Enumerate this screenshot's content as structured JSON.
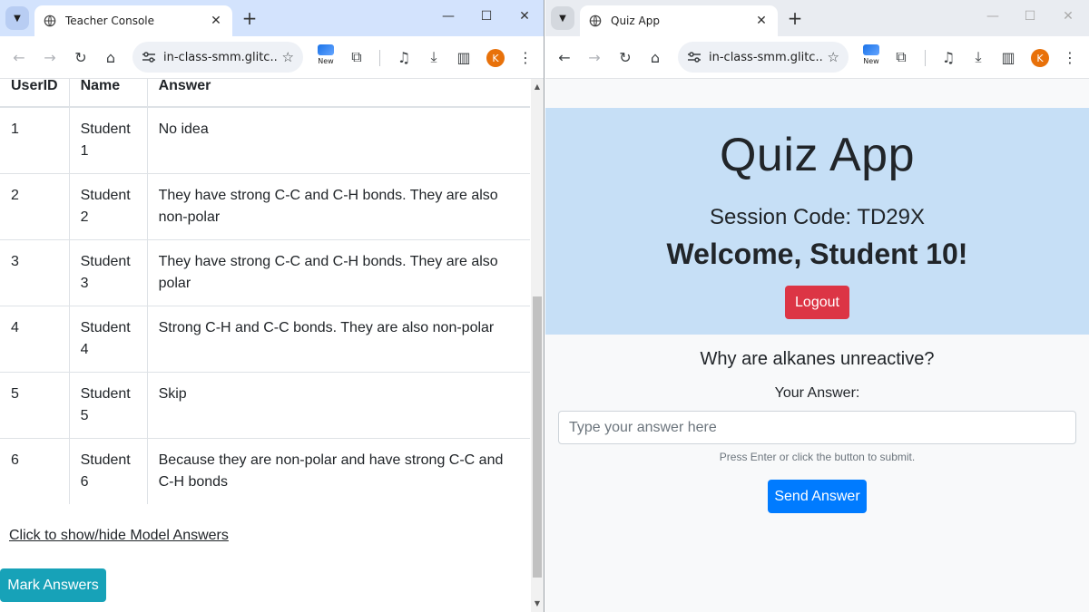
{
  "left_window": {
    "tab_title": "Teacher Console",
    "url": "in-class-smm.glitc...",
    "avatar_letter": "K",
    "new_badge": "New"
  },
  "right_window": {
    "tab_title": "Quiz App",
    "url": "in-class-smm.glitc...",
    "avatar_letter": "K",
    "new_badge": "New"
  },
  "teacher": {
    "columns": [
      "UserID",
      "Name",
      "Answer"
    ],
    "rows": [
      {
        "id": "1",
        "name": "Student 1",
        "answer": "No idea"
      },
      {
        "id": "2",
        "name": "Student 2",
        "answer": "They have strong C-C and C-H bonds. They are also non-polar"
      },
      {
        "id": "3",
        "name": "Student 3",
        "answer": "They have strong C-C and C-H bonds. They are also polar"
      },
      {
        "id": "4",
        "name": "Student 4",
        "answer": "Strong C-H and C-C bonds. They are also non-polar"
      },
      {
        "id": "5",
        "name": "Student 5",
        "answer": "Skip"
      },
      {
        "id": "6",
        "name": "Student 6",
        "answer": "Because they are non-polar and have strong C-C and C-H bonds"
      }
    ],
    "model_answers_link": "Click to show/hide Model Answers",
    "mark_button": "Mark Answers"
  },
  "quiz": {
    "title": "Quiz App",
    "session": "Session Code: TD29X",
    "welcome": "Welcome, Student 10!",
    "logout": "Logout",
    "question": "Why are alkanes unreactive?",
    "answer_label": "Your Answer:",
    "answer_placeholder": "Type your answer here",
    "hint": "Press Enter or click the button to submit.",
    "send_button": "Send Answer"
  },
  "colors": {
    "hero_bg": "#c6dff6",
    "logout_red": "#dc3545",
    "send_blue": "#007bff",
    "mark_teal": "#17a2b8",
    "avatar_orange": "#e8710a"
  }
}
